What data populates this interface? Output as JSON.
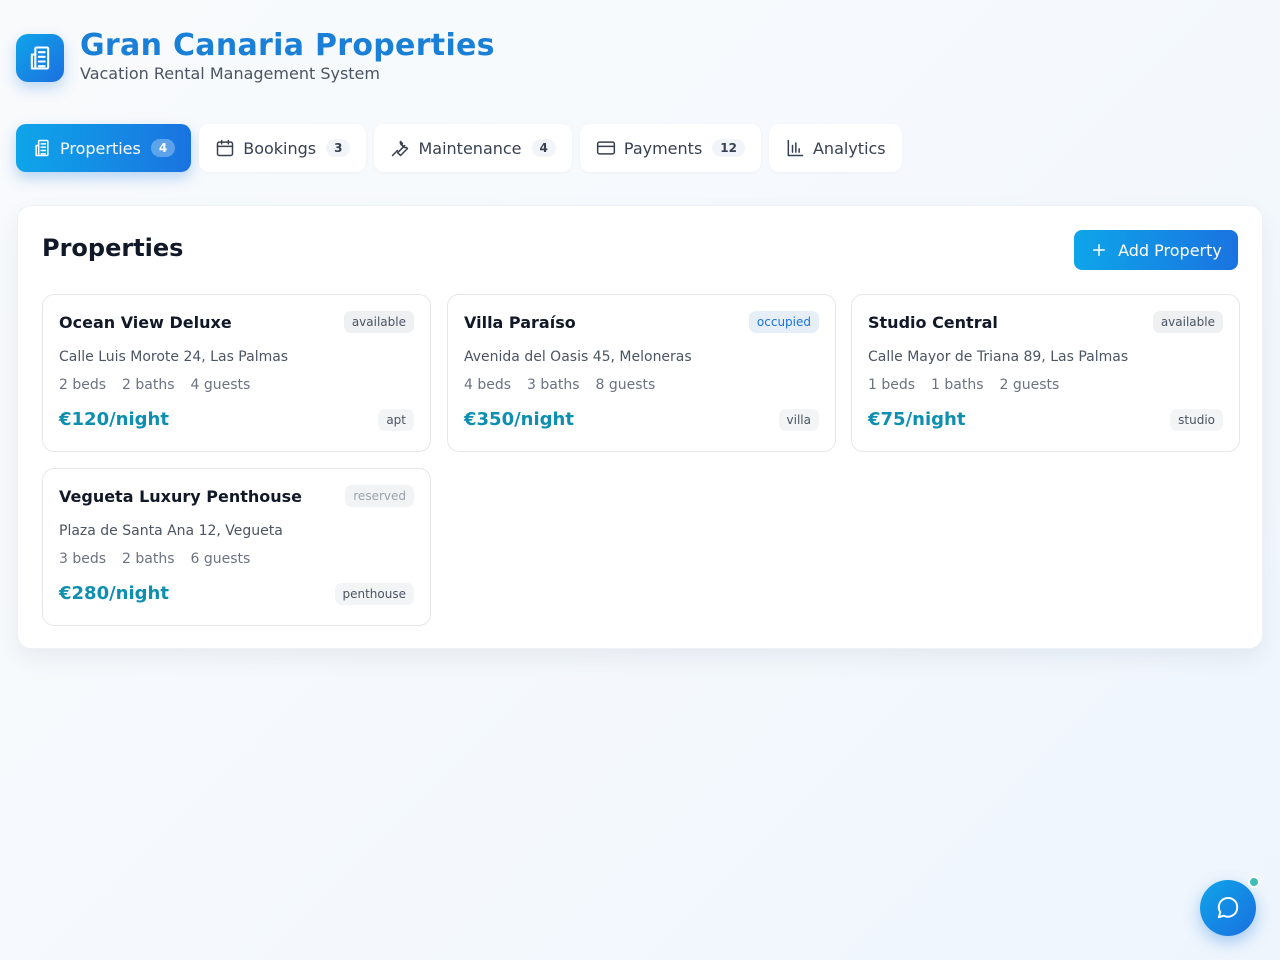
{
  "header": {
    "title": "Gran Canaria Properties",
    "subtitle": "Vacation Rental Management System",
    "logo_icon": "building-icon"
  },
  "tabs": [
    {
      "label": "Properties",
      "count": "4",
      "icon": "building-icon",
      "active": true
    },
    {
      "label": "Bookings",
      "count": "3",
      "icon": "calendar-icon",
      "active": false
    },
    {
      "label": "Maintenance",
      "count": "4",
      "icon": "wrench-icon",
      "active": false
    },
    {
      "label": "Payments",
      "count": "12",
      "icon": "credit-card-icon",
      "active": false
    },
    {
      "label": "Analytics",
      "icon": "bar-chart-icon",
      "active": false
    }
  ],
  "panel": {
    "title": "Properties",
    "add_label": "Add Property"
  },
  "properties": [
    {
      "name": "Ocean View Deluxe",
      "status": "available",
      "address": "Calle Luis Morote 24, Las Palmas",
      "beds": "2 beds",
      "baths": "2 baths",
      "guests": "4 guests",
      "price": "€120/night",
      "type": "apt"
    },
    {
      "name": "Villa Paraíso",
      "status": "occupied",
      "address": "Avenida del Oasis 45, Meloneras",
      "beds": "4 beds",
      "baths": "3 baths",
      "guests": "8 guests",
      "price": "€350/night",
      "type": "villa"
    },
    {
      "name": "Studio Central",
      "status": "available",
      "address": "Calle Mayor de Triana 89, Las Palmas",
      "beds": "1 beds",
      "baths": "1 baths",
      "guests": "2 guests",
      "price": "€75/night",
      "type": "studio"
    },
    {
      "name": "Vegueta Luxury Penthouse",
      "status": "reserved",
      "address": "Plaza de Santa Ana 12, Vegueta",
      "beds": "3 beds",
      "baths": "2 baths",
      "guests": "6 guests",
      "price": "€280/night",
      "type": "penthouse"
    }
  ],
  "colors": {
    "brand": "#1a7fd6",
    "accent_start": "#0ea5e9",
    "accent_end": "#1a73e0",
    "price": "#0e8fb0",
    "chat_dot": "#3fbfb5"
  }
}
